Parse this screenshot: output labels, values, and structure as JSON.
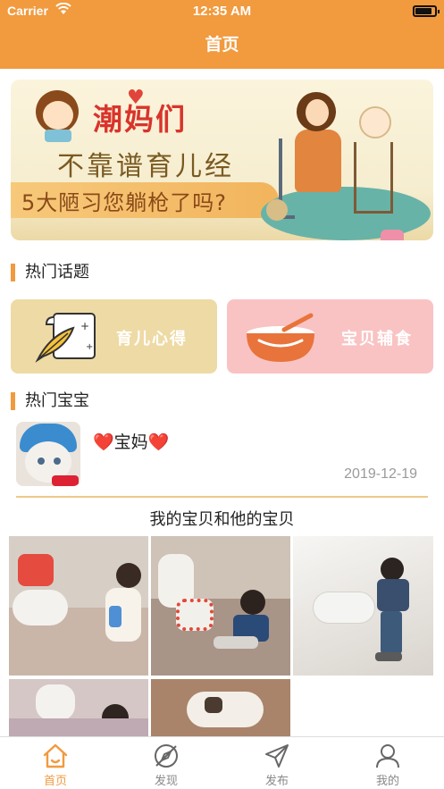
{
  "status_bar": {
    "carrier": "Carrier",
    "time": "12:35 AM"
  },
  "nav": {
    "title": "首页"
  },
  "banner": {
    "brand": "潮妈们",
    "line2": "不靠谱育儿经",
    "line3": "5大陋习您躺枪了吗?"
  },
  "hot_topics": {
    "title": "热门话题",
    "cards": [
      {
        "label": "育儿心得",
        "icon": "scroll-quill-icon",
        "color": "#eedaa5"
      },
      {
        "label": "宝贝辅食",
        "icon": "bowl-icon",
        "color": "#f9c3c3"
      }
    ]
  },
  "hot_babies": {
    "title": "热门宝宝",
    "post": {
      "author": "❤️宝妈❤️",
      "date": "2019-12-19"
    }
  },
  "album": {
    "title": "我的宝贝和他的宝贝"
  },
  "tabs": [
    {
      "label": "首页",
      "icon": "home-icon",
      "active": true
    },
    {
      "label": "发现",
      "icon": "compass-icon",
      "active": false
    },
    {
      "label": "发布",
      "icon": "send-icon",
      "active": false
    },
    {
      "label": "我的",
      "icon": "user-icon",
      "active": false
    }
  ],
  "colors": {
    "accent": "#f19a3e",
    "date": "#9a9a9a"
  }
}
